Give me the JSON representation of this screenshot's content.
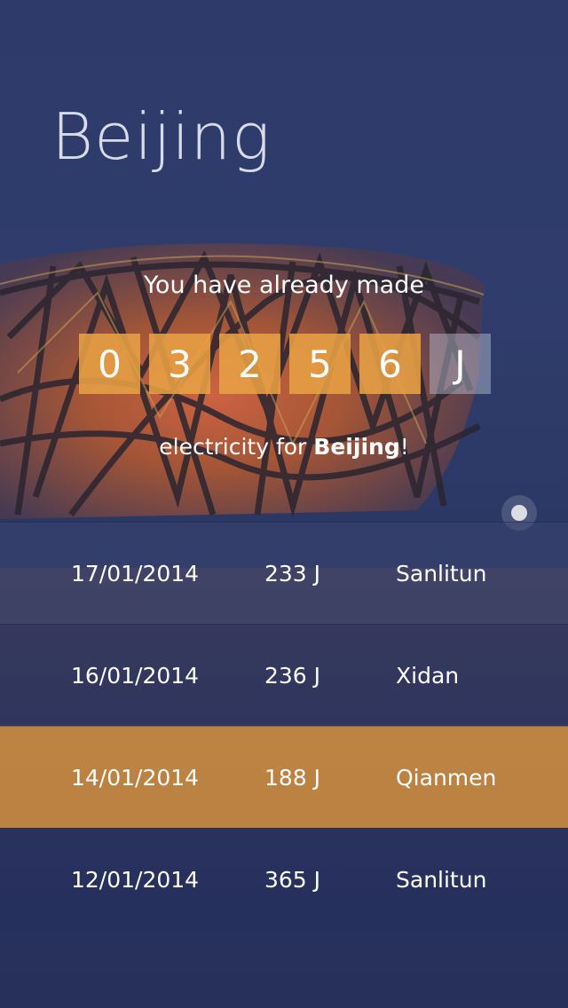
{
  "city": "Beijing",
  "summary": {
    "intro": "You have already made",
    "digits": [
      "0",
      "3",
      "2",
      "5",
      "6"
    ],
    "unit": "J",
    "tagline_prefix": "electricity for ",
    "tagline_city": "Beijing",
    "tagline_suffix": "!"
  },
  "history": [
    {
      "date": "17/01/2014",
      "amount": "233 J",
      "place": "Sanlitun"
    },
    {
      "date": "16/01/2014",
      "amount": "236 J",
      "place": "Xidan"
    },
    {
      "date": "14/01/2014",
      "amount": "188 J",
      "place": "Qianmen"
    },
    {
      "date": "12/01/2014",
      "amount": "365 J",
      "place": "Sanlitun"
    }
  ],
  "colors": {
    "background": "#2c3864",
    "accent": "#e8a044",
    "highlight_row": "#e0963c"
  }
}
